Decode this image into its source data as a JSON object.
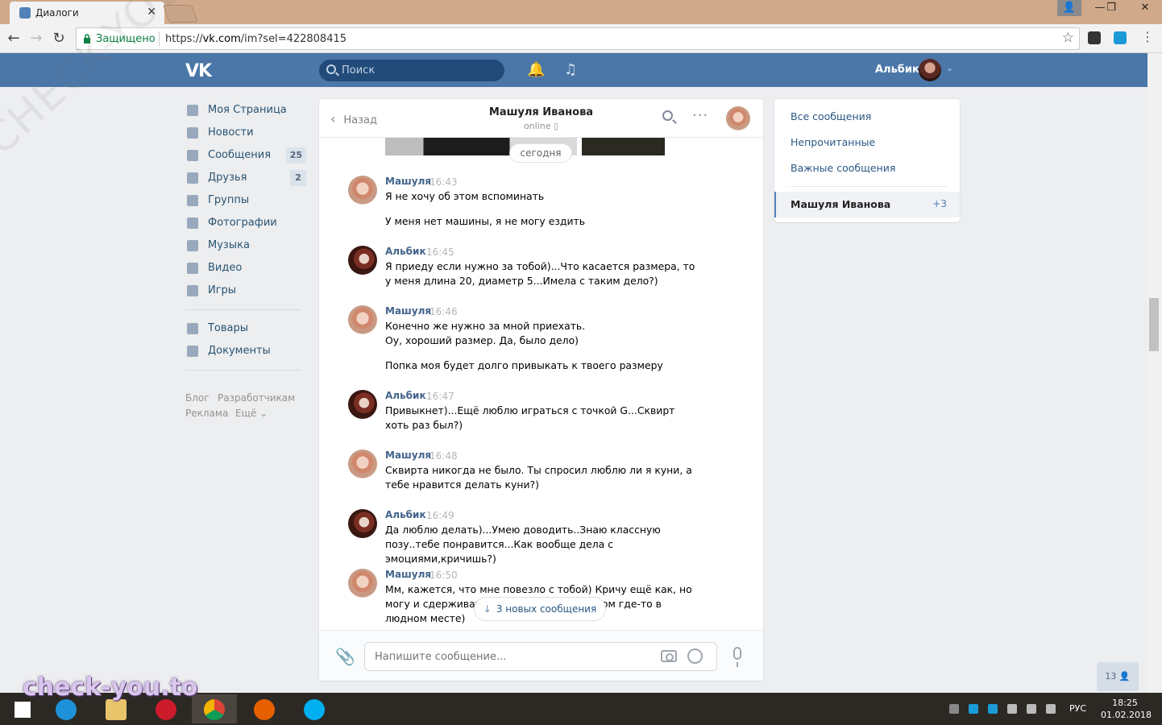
{
  "browser": {
    "tab_title": "Диалоги",
    "tab_close": "✕",
    "secure_label": "Защищено",
    "url_scheme": "https://",
    "url_host": "vk.com",
    "url_path": "/im?sel=422808415",
    "star": "☆",
    "window_controls": [
      "—",
      "❐",
      "✕"
    ]
  },
  "vk_header": {
    "logo": "VK",
    "search_placeholder": "Поиск",
    "bell_icon": "🔔",
    "music_icon": "♫",
    "user_name": "Альбик",
    "caret": "⌄"
  },
  "left_nav": {
    "items": [
      {
        "label": "Моя Страница",
        "count": ""
      },
      {
        "label": "Новости",
        "count": ""
      },
      {
        "label": "Сообщения",
        "count": "25"
      },
      {
        "label": "Друзья",
        "count": "2"
      },
      {
        "label": "Группы",
        "count": ""
      },
      {
        "label": "Фотографии",
        "count": ""
      },
      {
        "label": "Музыка",
        "count": ""
      },
      {
        "label": "Видео",
        "count": ""
      },
      {
        "label": "Игры",
        "count": ""
      }
    ],
    "items2": [
      {
        "label": "Товары"
      },
      {
        "label": "Документы"
      }
    ],
    "footer": [
      "Блог",
      "Разработчикам",
      "Реклама",
      "Ещё ⌄"
    ]
  },
  "chat": {
    "back_label": "Назад",
    "back_chevron": "‹",
    "contact_name": "Машуля Иванова",
    "contact_status": "online ▯",
    "more_icon": "···",
    "date_pill": "сегодня",
    "messages": [
      {
        "author": "Машуля",
        "time": "16:43",
        "lines": [
          "Я не хочу об этом вспоминать",
          "У меня нет машины, я не могу ездить"
        ]
      },
      {
        "author": "Альбик",
        "time": "16:45",
        "lines": [
          "Я приеду если нужно за тобой)...Что касается размера, то у меня длина 20, диаметр 5...Имела с таким дело?)"
        ]
      },
      {
        "author": "Машуля",
        "time": "16:46",
        "lines": [
          "Конечно же нужно за мной приехать.",
          "Оу, хороший размер. Да, было дело)",
          "Попка моя будет долго привыкать к твоего размеру"
        ]
      },
      {
        "author": "Альбик",
        "time": "16:47",
        "lines": [
          "Привыкнет)...Ещё люблю играться с точкой G...Сквирт хоть раз был?)"
        ]
      },
      {
        "author": "Машуля",
        "time": "16:48",
        "lines": [
          "Сквирта никогда не было. Ты спросил люблю ли я куни, а тебе нравится делать куни?)"
        ]
      },
      {
        "author": "Альбик",
        "time": "16:49",
        "lines": [
          "Да люблю делать)...Умею доводить..Знаю классную позу..тебе понравится...Как вообще дела с эмоциями,кричишь?)"
        ]
      },
      {
        "author": "Машуля",
        "time": "16:50",
        "lines": [
          "Мм, кажется, что мне повезло с тобой) Кричу ещё как, но могу и сдерживаться, е",
          "ся сексом где-то в",
          "людном месте)"
        ]
      }
    ],
    "new_messages_label": "3 новых сообщения",
    "new_messages_arrow": "↓",
    "input_placeholder": "Напишите сообщение...",
    "attach_icon": "📎"
  },
  "right_panel": {
    "filters": [
      "Все сообщения",
      "Непрочитанные",
      "Важные сообщения"
    ],
    "active_dialog": {
      "name": "Машуля Иванова",
      "count": "+3"
    }
  },
  "online_counter": "13 👤",
  "taskbar": {
    "lang": "РУС",
    "time": "18:25",
    "date": "01.02.2018"
  },
  "watermarks": {
    "bottom": "check-you.to",
    "diagonal": "CHECK-YOU.ME"
  }
}
